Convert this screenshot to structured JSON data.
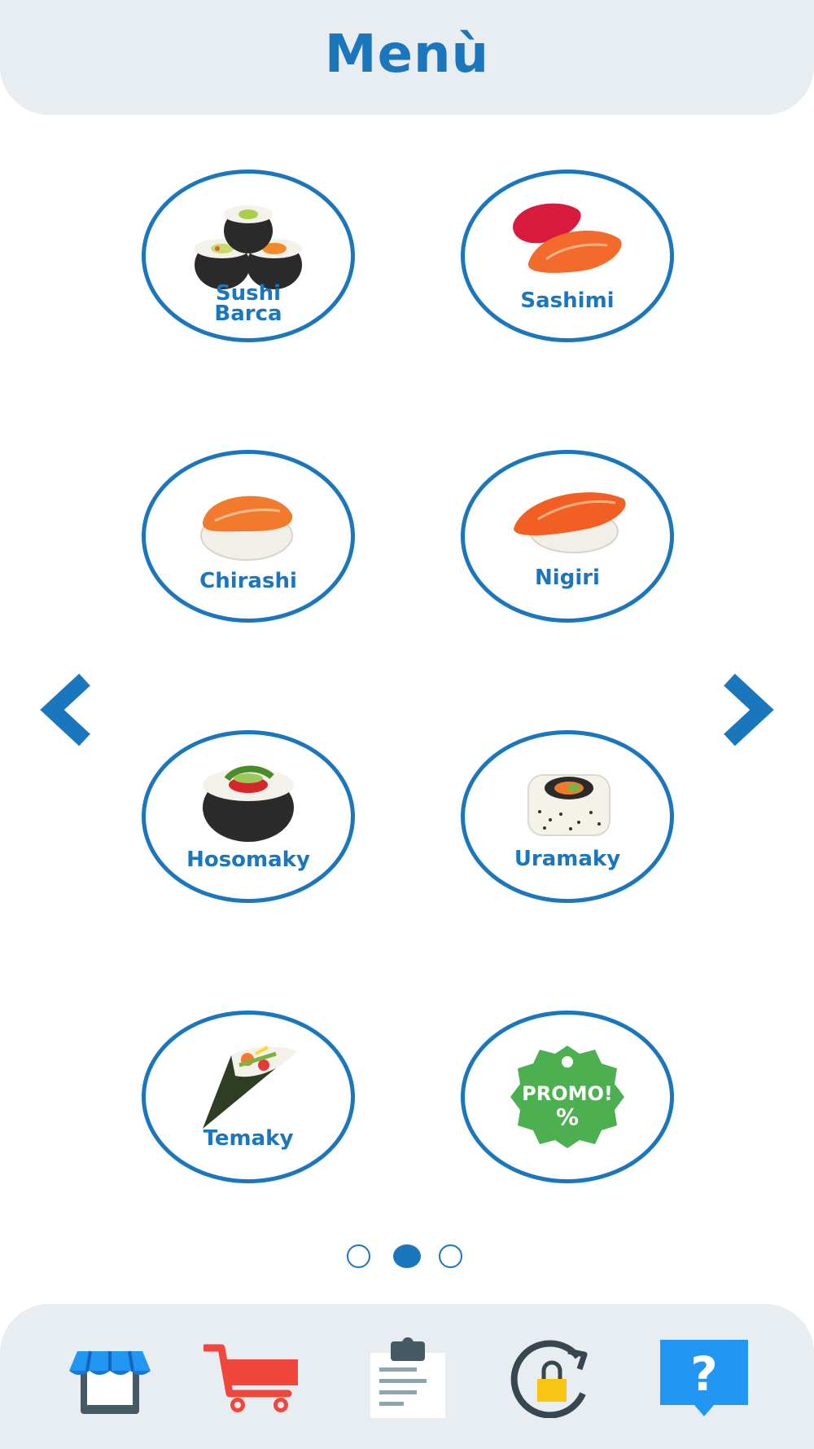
{
  "header": {
    "title": "Menù"
  },
  "menu": {
    "items": [
      {
        "label_line1": "Sushi",
        "label_line2": "Barca",
        "icon": "sushi-rolls-icon"
      },
      {
        "label": "Sashimi",
        "icon": "sashimi-icon"
      },
      {
        "label": "Chirashi",
        "icon": "chirashi-icon"
      },
      {
        "label": "Nigiri",
        "icon": "nigiri-icon"
      },
      {
        "label": "Hosomaky",
        "icon": "hosomaky-icon"
      },
      {
        "label": "Uramaky",
        "icon": "uramaky-icon"
      },
      {
        "label": "Temaky",
        "icon": "temaky-icon"
      },
      {
        "promo_line1": "PROMO!",
        "promo_line2": "%",
        "icon": "promo-badge-icon"
      }
    ]
  },
  "pagination": {
    "current_page": 2,
    "total_pages": 3
  },
  "nav": {
    "icons": [
      "shop-icon",
      "cart-icon",
      "clipboard-icon",
      "lock-rotate-icon",
      "help-icon"
    ],
    "help_symbol": "?"
  },
  "colors": {
    "accent": "#1a76bd",
    "bar_background": "#e8edf2",
    "cart_red": "#f0463c",
    "promo_green": "#4caf50",
    "help_blue": "#2196f3",
    "lock_yellow": "#f9c513"
  }
}
